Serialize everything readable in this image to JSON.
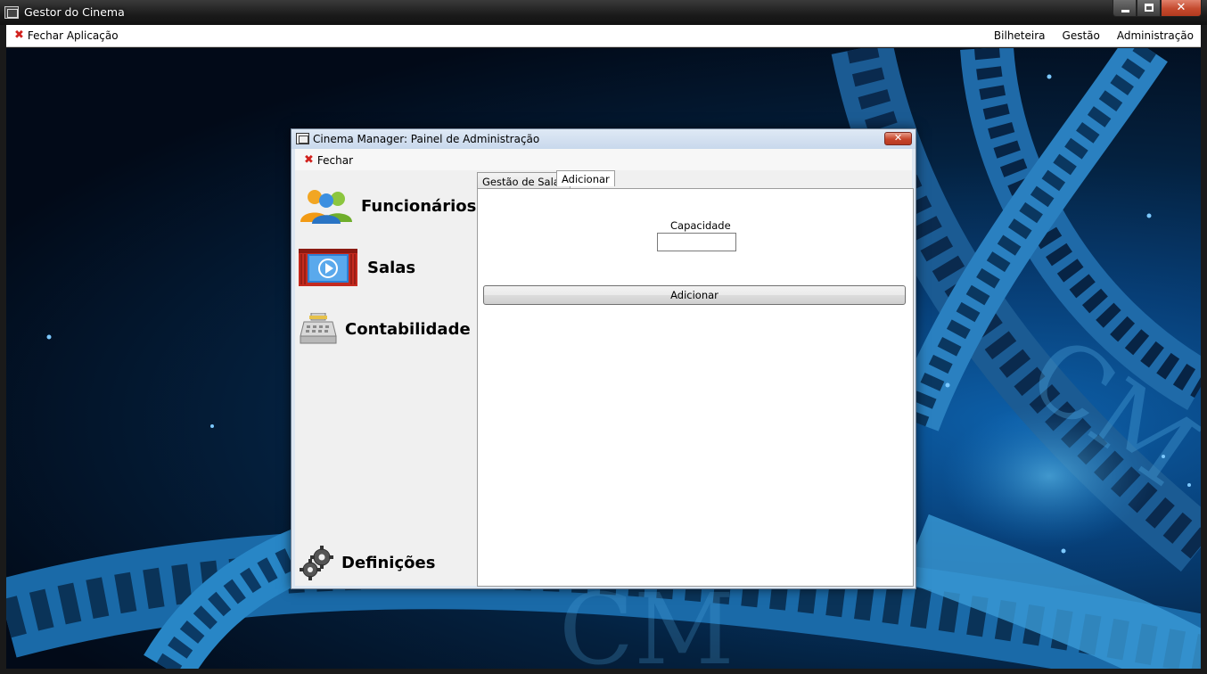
{
  "main_window": {
    "title": "Gestor do Cinema",
    "menu": {
      "close_app": "Fechar Aplicação",
      "items": [
        "Bilheteira",
        "Gestão",
        "Administração"
      ]
    },
    "close_glyph": "✕"
  },
  "background": {
    "logo_text": "CM"
  },
  "dialog": {
    "title": "Cinema Manager: Painel de Administração",
    "close_glyph": "✕",
    "menu_close": "Fechar",
    "sidebar": [
      {
        "label": "Funcionários",
        "icon": "users-icon"
      },
      {
        "label": "Salas",
        "icon": "cinema-room-icon"
      },
      {
        "label": "Contabilidade",
        "icon": "cash-register-icon"
      },
      {
        "label": "Definições",
        "icon": "gears-icon"
      }
    ],
    "tabs": [
      {
        "label": "Gestão de Salas",
        "active": false
      },
      {
        "label": "Adicionar",
        "active": true
      }
    ],
    "form": {
      "capacity_label": "Capacidade",
      "capacity_value": "",
      "add_button": "Adicionar"
    }
  },
  "colors": {
    "close_red": "#c6452b",
    "x_red": "#d1221e",
    "background_blue": "#0d5fa8"
  }
}
